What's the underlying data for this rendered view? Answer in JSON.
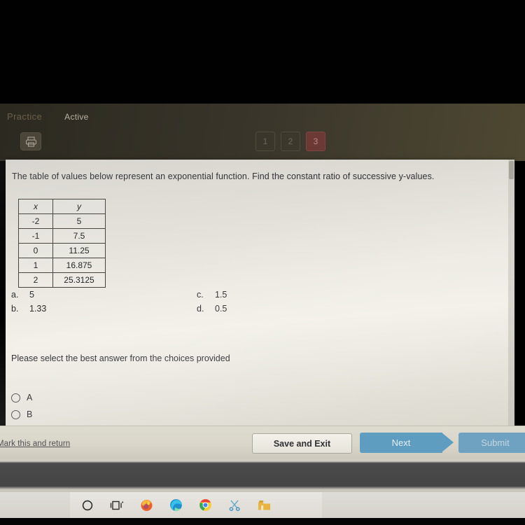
{
  "chrome": {
    "tab_practice": "Practice",
    "tab_active": "Active",
    "print_icon": "printer-icon",
    "pages": [
      "1",
      "2",
      "3"
    ],
    "current_page": "3",
    "accent_red": "#6b3a35"
  },
  "question": {
    "text": "The table of values below represent an exponential function. Find the constant ratio of successive y-values.",
    "table": {
      "headers": [
        "x",
        "y"
      ],
      "rows": [
        [
          "-2",
          "5"
        ],
        [
          "-1",
          "7.5"
        ],
        [
          "0",
          "11.25"
        ],
        [
          "1",
          "16.875"
        ],
        [
          "2",
          "25.3125"
        ]
      ]
    },
    "choices": [
      {
        "label": "a.",
        "value": "5"
      },
      {
        "label": "b.",
        "value": "1.33"
      },
      {
        "label": "c.",
        "value": "1.5"
      },
      {
        "label": "d.",
        "value": "0.5"
      }
    ],
    "prompt": "Please select the best answer from the choices provided",
    "options": [
      {
        "label": "A",
        "selected": false
      },
      {
        "label": "B",
        "selected": false
      }
    ]
  },
  "footer": {
    "mark_return": "Mark this and return",
    "save_exit": "Save and Exit",
    "next": "Next",
    "submit": "Submit",
    "next_color": "#5e9cc0",
    "submit_color": "#6fa2c0"
  },
  "taskbar": {
    "icons": [
      "search-circle-icon",
      "task-view-icon",
      "firefox-icon",
      "edge-icon",
      "chrome-icon",
      "snipping-tool-icon",
      "file-explorer-icon"
    ]
  }
}
